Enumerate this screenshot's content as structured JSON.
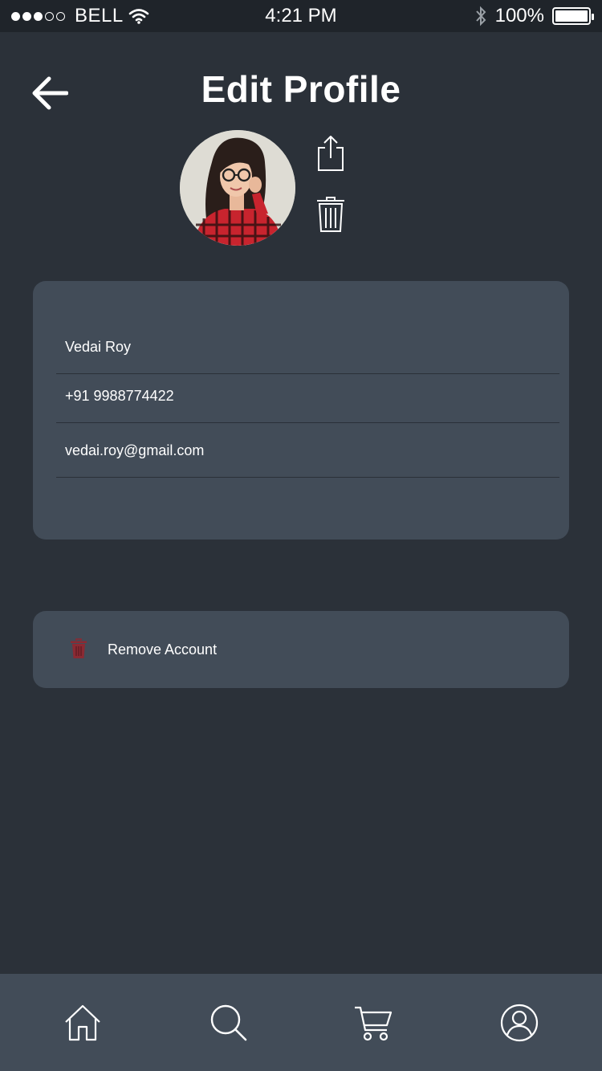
{
  "status_bar": {
    "carrier": "BELL",
    "time": "4:21 PM",
    "battery": "100%",
    "signal_bars_filled": 3,
    "signal_bars_total": 5
  },
  "header": {
    "title": "Edit Profile"
  },
  "profile": {
    "name": "Vedai Roy",
    "phone": "+91 9988774422",
    "email": "vedai.roy@gmail.com"
  },
  "remove_account": {
    "label": "Remove Account",
    "icon_color": "#8b2a33"
  },
  "nav": {
    "items": [
      "home-icon",
      "search-icon",
      "cart-icon",
      "profile-icon"
    ]
  },
  "colors": {
    "background": "#2b3139",
    "card": "#424c58",
    "status_bar": "#1f242a"
  }
}
